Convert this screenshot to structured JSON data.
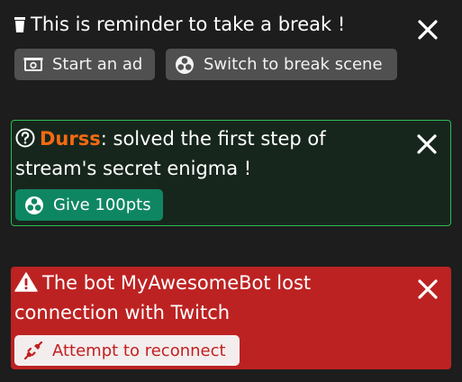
{
  "notifications": [
    {
      "icon": "trash-can-icon",
      "message": "This is reminder to take a break !",
      "buttons": [
        {
          "label": "Start an ad",
          "icon": "cash-icon"
        },
        {
          "label": "Switch to break scene",
          "icon": "obs-icon"
        }
      ],
      "close_icon": "close-icon"
    },
    {
      "icon": "question-circle-icon",
      "user": "Durss",
      "separator": ":",
      "message": " solved the first step of stream's secret enigma !",
      "buttons": [
        {
          "label": "Give 100pts",
          "icon": "obs-icon"
        }
      ],
      "accent_color": "#2dbe55",
      "user_color": "#f56a12",
      "close_icon": "close-icon"
    },
    {
      "icon": "warning-triangle-icon",
      "message": "The bot MyAwesomeBot lost connection with Twitch",
      "buttons": [
        {
          "label": "Attempt to reconnect",
          "icon": "unplugged-icon"
        }
      ],
      "background_color": "#bd2222",
      "close_icon": "close-icon"
    }
  ]
}
